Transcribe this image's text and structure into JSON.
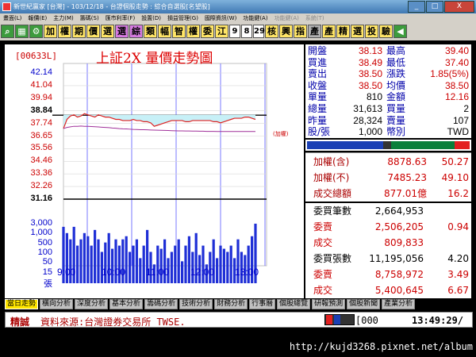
{
  "window": {
    "title": "新世紀贏家 [台灣] - 103/12/18 - 台證個股走勢 : 綜合自選股[名望股]",
    "buttons": [
      "_",
      "□",
      "X"
    ]
  },
  "menu": [
    {
      "label": "畫面(L)",
      "dim": false
    },
    {
      "label": "報價(E)",
      "dim": false
    },
    {
      "label": "主力(M)",
      "dim": false
    },
    {
      "label": "籌碼(S)",
      "dim": false
    },
    {
      "label": "匯市利率(F)",
      "dim": false
    },
    {
      "label": "設置(D)",
      "dim": false
    },
    {
      "label": "損益管理(G)",
      "dim": false
    },
    {
      "label": "國際資訊(W)",
      "dim": false
    },
    {
      "label": "功能鍵(A)",
      "dim": false
    },
    {
      "label": "功能鍵(A)",
      "dim": true
    },
    {
      "label": "系統(T)",
      "dim": true
    }
  ],
  "toolbar": [
    {
      "label": "⌕",
      "style": "g"
    },
    {
      "label": "▦",
      "style": "g"
    },
    {
      "label": "⚙",
      "style": "g"
    },
    {
      "label": "加",
      "style": "y"
    },
    {
      "label": "權",
      "style": "y"
    },
    {
      "label": "期",
      "style": "y"
    },
    {
      "label": "價",
      "style": "y"
    },
    {
      "label": "選",
      "style": "y"
    },
    {
      "label": "選",
      "style": "p"
    },
    {
      "label": "綜",
      "style": "p"
    },
    {
      "label": "類",
      "style": "y"
    },
    {
      "label": "幅",
      "style": "y"
    },
    {
      "label": "智",
      "style": "y"
    },
    {
      "label": "權",
      "style": "y"
    },
    {
      "label": "委",
      "style": "y"
    },
    {
      "label": "江",
      "style": "y"
    },
    {
      "label": "9",
      "style": "num"
    },
    {
      "label": "8",
      "style": "num"
    },
    {
      "label": "29",
      "style": "num"
    },
    {
      "label": "核",
      "style": "y"
    },
    {
      "label": "興",
      "style": "y"
    },
    {
      "label": "指",
      "style": "y"
    },
    {
      "label": "產",
      "style": "gr"
    },
    {
      "label": "產",
      "style": "y"
    },
    {
      "label": "精",
      "style": "y"
    },
    {
      "label": "選",
      "style": "y"
    },
    {
      "label": "投",
      "style": "y"
    },
    {
      "label": "驗",
      "style": "y"
    },
    {
      "label": "◀",
      "style": "g"
    }
  ],
  "chart": {
    "code": "[00633L]",
    "title": "上証2X  量價走勢圖",
    "note": "(加權)"
  },
  "chart_data": {
    "type": "line",
    "ylabels": [
      {
        "label": "42.14",
        "color": "bl"
      },
      {
        "label": "41.04",
        "color": "up"
      },
      {
        "label": "39.94",
        "color": "up"
      },
      {
        "label": "38.84",
        "color": "k"
      },
      {
        "label": "37.74",
        "color": "up"
      },
      {
        "label": "36.65",
        "color": "up"
      },
      {
        "label": "35.56",
        "color": "dn"
      },
      {
        "label": "34.46",
        "color": "dn"
      },
      {
        "label": "33.36",
        "color": "dn"
      },
      {
        "label": "32.26",
        "color": "dn"
      },
      {
        "label": "31.16",
        "color": "k"
      }
    ],
    "volume_labels": [
      "3,000",
      "1,000",
      "500",
      "100",
      "50",
      "15",
      "張"
    ],
    "xlabels": [
      "9:00",
      "10:00",
      "11:00",
      "12:00",
      "13:00"
    ],
    "ylim": [
      31.16,
      42.14
    ],
    "reference": 38.5,
    "price": [
      37.3,
      38.1,
      38.4,
      38.5,
      38.3,
      38.4,
      38.6,
      38.5,
      38.4,
      38.3,
      38.5,
      38.4,
      38.3,
      38.3,
      38.2,
      38.1,
      38.1,
      38.0,
      38.0,
      38.0,
      38.1,
      38.0,
      38.0,
      37.9,
      37.9,
      37.8,
      37.5,
      37.6,
      37.7,
      37.8,
      37.9,
      38.0,
      38.0,
      38.0,
      38.0,
      37.9,
      37.9,
      38.0,
      38.0,
      38.0,
      38.0,
      38.0,
      38.0,
      37.9,
      37.9,
      37.8,
      37.9,
      38.0,
      38.1,
      38.2,
      38.2,
      38.2,
      38.3,
      38.3,
      38.2,
      38.1
    ],
    "avg_price": [
      37.3,
      37.4,
      37.45,
      37.5,
      37.5,
      37.52,
      37.5,
      37.5,
      37.48,
      37.46,
      37.44,
      37.42,
      37.4,
      37.38,
      37.35,
      37.33,
      37.3,
      37.28,
      37.27,
      37.25,
      37.23,
      37.22,
      37.2,
      37.2,
      37.19,
      37.18,
      37.17,
      37.16,
      37.15,
      37.14,
      37.13,
      37.12,
      37.11,
      37.1,
      37.1,
      37.09,
      37.09,
      37.08,
      37.08,
      37.07,
      37.07,
      37.06,
      37.06,
      37.06,
      37.05,
      37.05,
      37.05,
      37.05,
      37.05,
      37.05,
      37.05,
      37.05,
      37.05,
      37.05,
      37.05,
      37.05
    ],
    "volume": [
      0.9,
      0.8,
      0.7,
      0.9,
      0.6,
      0.7,
      0.8,
      0.75,
      0.6,
      0.85,
      0.7,
      0.5,
      0.65,
      0.8,
      0.55,
      0.7,
      0.6,
      0.7,
      0.75,
      0.5,
      0.6,
      0.7,
      0.4,
      0.6,
      0.85,
      0.5,
      0.3,
      0.6,
      0.55,
      0.7,
      0.4,
      0.5,
      0.6,
      0.7,
      0.35,
      0.6,
      0.75,
      0.5,
      0.8,
      0.45,
      0.6,
      0.3,
      0.5,
      0.7,
      0.4,
      0.6,
      0.55,
      0.5,
      0.6,
      0.4,
      0.7,
      0.5,
      0.45,
      0.6,
      0.75,
      0.95
    ]
  },
  "quote": [
    {
      "l1": "開盤",
      "v1": "38.13",
      "c1": "red",
      "l2": "最高",
      "v2": "39.40",
      "c2": "red"
    },
    {
      "l1": "買進",
      "v1": "38.49",
      "c1": "red",
      "l2": "最低",
      "v2": "37.40",
      "c2": "red"
    },
    {
      "l1": "賣出",
      "v1": "38.50",
      "c1": "red",
      "l2": "漲跌",
      "v2": "1.85(5%)",
      "c2": "red"
    },
    {
      "l1": "收盤",
      "v1": "38.50",
      "c1": "red",
      "l2": "均價",
      "v2": "38.50",
      "c2": "red"
    },
    {
      "l1": "單量",
      "v1": "810",
      "c1": "blk",
      "l2": "金額",
      "v2": "12.16",
      "c2": "red"
    },
    {
      "l1": "總量",
      "v1": "31,613",
      "c1": "blk",
      "l2": "買量",
      "v2": "2",
      "c2": "blk"
    },
    {
      "l1": "昨量",
      "v1": "28,324",
      "c1": "blk",
      "l2": "賣量",
      "v2": "107",
      "c2": "blk"
    },
    {
      "l1": "股/張",
      "v1": "1,000",
      "c1": "blk",
      "l2": "幣別",
      "v2": "TWD",
      "c2": "blk"
    }
  ],
  "index": [
    {
      "a": "加權(含)",
      "b": "8878.63",
      "c": "50.27"
    },
    {
      "a": "加權(不)",
      "b": "7485.23",
      "c": "49.10"
    },
    {
      "a": "成交總額",
      "b": "877.01億",
      "c": "16.2"
    }
  ],
  "volumes": [
    {
      "a": "委買筆數",
      "b": "2,664,953",
      "c": ""
    },
    {
      "a": "委賣",
      "b": "2,506,205",
      "c": "0.94"
    },
    {
      "a": "成交",
      "b": "809,833",
      "c": ""
    },
    {
      "a": "委買張數",
      "b": "11,195,056",
      "c": "4.20"
    },
    {
      "a": "委賣",
      "b": "8,758,972",
      "c": "3.49"
    },
    {
      "a": "成交",
      "b": "5,400,645",
      "c": "6.67"
    }
  ],
  "tabs": [
    "當日走勢",
    "橫向分析",
    "深度分析",
    "基本分析",
    "籌碼分析",
    "技術分析",
    "財務分析",
    "行事曆",
    "個股總覽",
    "研報預測",
    "個股新聞",
    "產業分析"
  ],
  "status": {
    "label": "精誠",
    "source": "資料來源:台灣證券交易所 TWSE.",
    "stock": "[000",
    "time": "13:49:29/"
  },
  "watermark": "http://kujd3268.pixnet.net/album"
}
